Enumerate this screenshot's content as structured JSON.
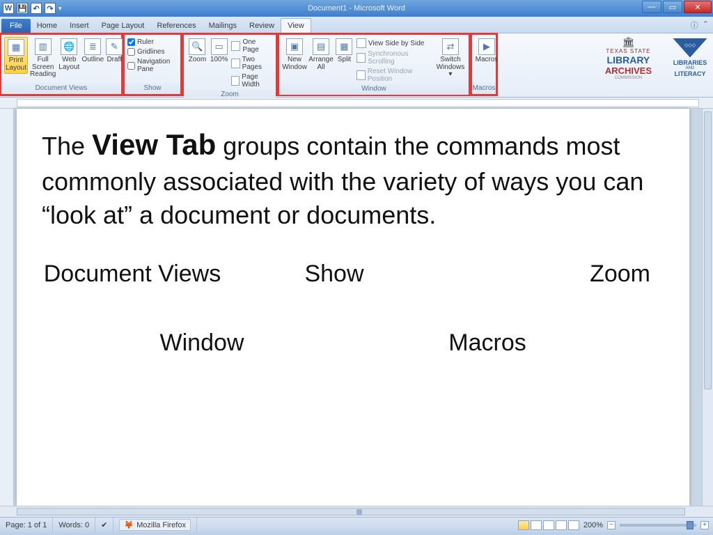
{
  "titlebar": {
    "title": "Document1  -  Microsoft Word"
  },
  "tabs": {
    "file": "File",
    "items": [
      "Home",
      "Insert",
      "Page Layout",
      "References",
      "Mailings",
      "Review",
      "View"
    ],
    "active": "View"
  },
  "ribbon": {
    "document_views": {
      "label": "Document Views",
      "print_layout": "Print Layout",
      "full_screen": "Full Screen Reading",
      "web_layout": "Web Layout",
      "outline": "Outline",
      "draft": "Draft"
    },
    "show": {
      "label": "Show",
      "ruler": "Ruler",
      "gridlines": "Gridlines",
      "navpane": "Navigation Pane"
    },
    "zoom": {
      "label": "Zoom",
      "zoom": "Zoom",
      "p100": "100%",
      "one_page": "One Page",
      "two_pages": "Two Pages",
      "page_width": "Page Width"
    },
    "window": {
      "label": "Window",
      "new_window": "New Window",
      "arrange_all": "Arrange All",
      "split": "Split",
      "side_by_side": "View Side by Side",
      "sync_scroll": "Synchronous Scrolling",
      "reset_pos": "Reset Window Position",
      "switch": "Switch Windows ▾"
    },
    "macros": {
      "label": "Macros",
      "macros": "Macros"
    }
  },
  "logos": {
    "lib_top1": "TEXAS STATE",
    "lib_line1": "LIBRARY",
    "lib_line2": "ARCHIVES",
    "lib_sub": "COMMISSION",
    "lit1": "LIBRARIES",
    "lit_and": "AND",
    "lit2": "LITERACY"
  },
  "doc": {
    "para_prefix": "The ",
    "para_bold": "View Tab",
    "para_rest": " groups contain the commands most commonly associated with the variety of ways you can “look at” a document or documents.",
    "lbl_docviews": "Document Views",
    "lbl_show": "Show",
    "lbl_zoom": "Zoom",
    "lbl_window": "Window",
    "lbl_macros": "Macros"
  },
  "status": {
    "page": "Page: 1 of 1",
    "words": "Words: 0",
    "task": "Mozilla Firefox",
    "zoom": "200%"
  }
}
